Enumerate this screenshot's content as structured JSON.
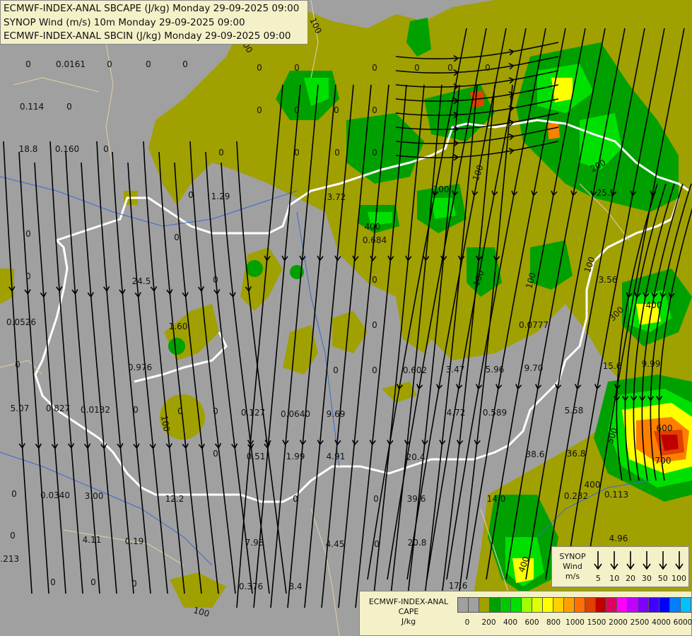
{
  "titles": [
    "ECMWF-INDEX-ANAL SBCAPE (J/kg) Monday 29-09-2025 09:00",
    "SYNOP Wind (m/s) 10m Monday 29-09-2025 09:00",
    "ECMWF-INDEX-ANAL SBCIN (J/kg) Monday 29-09-2025 09:00"
  ],
  "colors": {
    "background": "#a0a0a0",
    "cape_low": "#a0a000",
    "cape_green": "#00a000",
    "cape_bright": "#00e000",
    "cape_yellow": "#ffff00",
    "cape_orange": "#ff8000",
    "cape_red": "#c00000",
    "border": "#ffffff",
    "streamline": "#000000"
  },
  "map_labels": [
    "0",
    "0.0161",
    "0",
    "0",
    "0",
    "0.114",
    "0",
    "18.8",
    "0.160",
    "0",
    "0",
    "0",
    "0.0526",
    "0",
    "5.07",
    "0.827",
    "0.0132",
    "0",
    "0",
    "0.0340",
    "3.00",
    "0",
    "4.11",
    "0.19",
    "0",
    "1.29",
    "24.5",
    "1.60",
    "0.976",
    "12.2",
    "0.127",
    "0.0640",
    "9.69",
    "0.51",
    "1.99",
    "4.91",
    "7.98",
    "4.45",
    "0.376",
    "8.4",
    "3.72",
    "0.684",
    "0.602",
    "3.47",
    "5.96",
    "9.70",
    "4.72",
    "0.589",
    "20.4",
    "39.6",
    "20.8",
    "14.0",
    "38.6",
    "36.8",
    "0.232",
    "0.113",
    "0.0777",
    "5.58",
    "15.6",
    "9.99",
    "3.56",
    "25.5",
    "4.96",
    "17.6",
    "0.213",
    "0",
    "0",
    "0",
    "0",
    "0",
    "0",
    "0",
    "0",
    "0",
    "0",
    "0",
    "0",
    "0",
    "0",
    "0",
    "0",
    "0",
    "0",
    "0",
    "0",
    "0",
    "0",
    "0",
    "0",
    "0",
    "0",
    "0",
    "0",
    "0"
  ],
  "contour_labels": [
    "100",
    "100",
    "100",
    "100",
    "100",
    "100",
    "100",
    "200",
    "300",
    "400",
    "500",
    "600",
    "700",
    "400",
    "400",
    "400",
    "100",
    "100"
  ],
  "synop_legend": {
    "title_lines": [
      "SYNOP",
      "Wind",
      "m/s"
    ],
    "speeds": [
      "5",
      "10",
      "20",
      "30",
      "50",
      "100"
    ]
  },
  "cape_legend": {
    "title_lines": [
      "ECMWF-INDEX-ANAL",
      "CAPE",
      "J/kg"
    ],
    "swatch_colors": [
      "#a0a0a0",
      "#a0a0a0",
      "#a0a000",
      "#00a000",
      "#00c800",
      "#00e000",
      "#a0ff00",
      "#e0ff00",
      "#ffff00",
      "#ffd000",
      "#ffa000",
      "#ff7000",
      "#e04000",
      "#c00000",
      "#e00060",
      "#ff00ff",
      "#c000ff",
      "#8000ff",
      "#4000ff",
      "#0000ff",
      "#0080ff",
      "#00c0ff",
      "#00ffff",
      "#ffffff"
    ],
    "ticks": [
      "0",
      "200",
      "400",
      "600",
      "800",
      "1000",
      "1500",
      "2000",
      "2500",
      "4000",
      "6000"
    ]
  }
}
